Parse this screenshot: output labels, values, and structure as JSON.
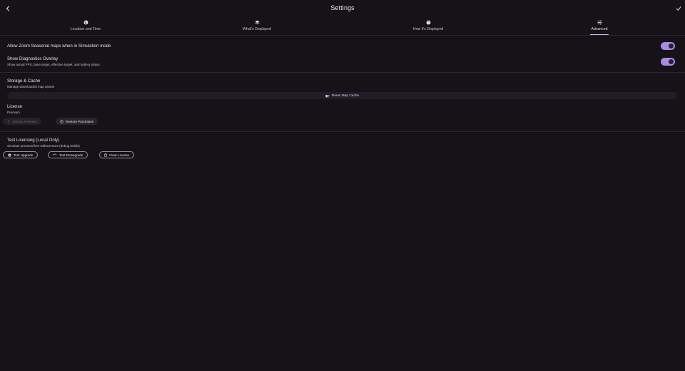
{
  "header": {
    "title": "Settings",
    "back_icon": "chevron-left-icon",
    "done_icon": "check-icon"
  },
  "tabs": [
    {
      "label": "Location and Time",
      "icon": "globe-icon",
      "active": false
    },
    {
      "label": "What's Displayed",
      "icon": "layers-icon",
      "active": false
    },
    {
      "label": "How it's Displayed",
      "icon": "palette-icon",
      "active": false
    },
    {
      "label": "Advanced",
      "icon": "tune-icon",
      "active": true
    }
  ],
  "advanced": {
    "zoom_seasonal": {
      "title": "Allow Zoom Seasonal maps when in Simulation mode",
      "enabled": true
    },
    "diagnostics": {
      "title": "Show Diagnostics Overlay",
      "subtitle": "Show actual FPS, base target, effective target, and battery status.",
      "enabled": true
    },
    "storage": {
      "title": "Storage & Cache",
      "subtitle": "Manage downloaded map assets",
      "reset_label": "Reset Map Cache"
    },
    "license": {
      "title": "License",
      "status": "Premium",
      "already_premium_label": "Already Premium",
      "restore_label": "Restore Purchases"
    },
    "test_licensing": {
      "title": "Test Licensing (Local Only)",
      "subtitle": "Simulate premium/free without store (debug builds)",
      "upgrade_label": "Test Upgrade",
      "downgrade_label": "Test Downgrade",
      "clear_label": "Clear License"
    }
  },
  "colors": {
    "background": "#151218",
    "accent": "#d4bbff",
    "switch_track": "#a98be0"
  }
}
